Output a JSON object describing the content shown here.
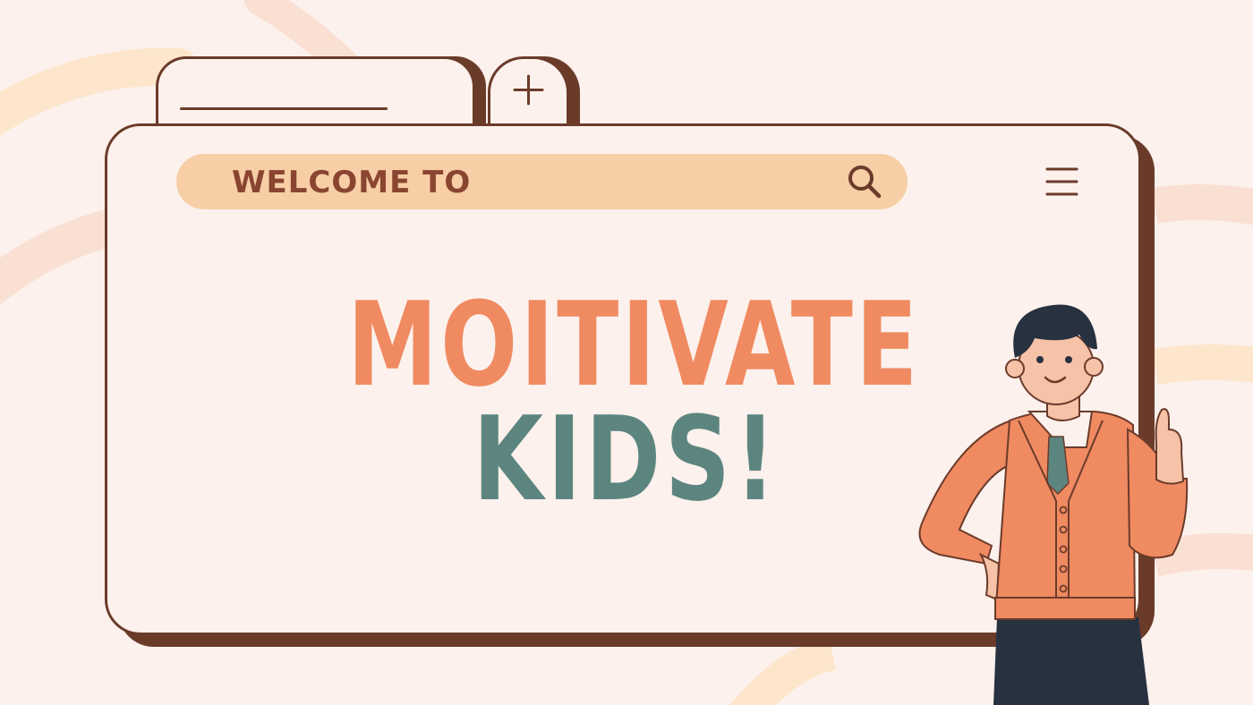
{
  "search": {
    "label": "WELCOME TO"
  },
  "headline": {
    "line1": "MOITIVATE",
    "line2": "KIDS!"
  },
  "icons": {
    "tab_new": "plus-icon",
    "search": "search-icon",
    "menu": "hamburger-menu-icon"
  },
  "colors": {
    "background": "#fcf1ec",
    "outline": "#6b3b2a",
    "search_bar": "#f7cea5",
    "search_text": "#8a4531",
    "headline_1": "#f08a61",
    "headline_2": "#5d8580"
  }
}
